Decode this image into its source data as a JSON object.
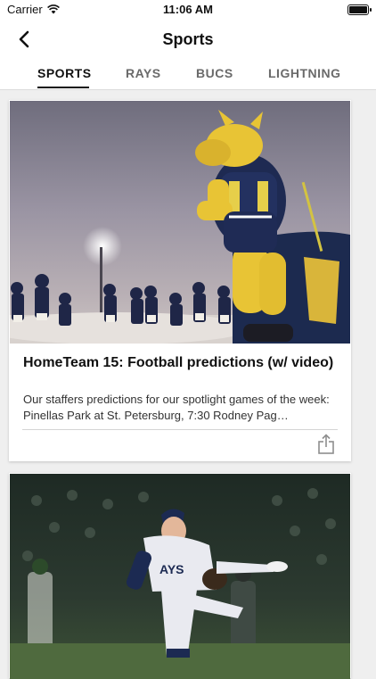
{
  "status_bar": {
    "carrier": "Carrier",
    "time": "11:06 AM"
  },
  "nav": {
    "title": "Sports"
  },
  "tabs": [
    {
      "label": "SPORTS",
      "active": true
    },
    {
      "label": "RAYS",
      "active": false
    },
    {
      "label": "BUCS",
      "active": false
    },
    {
      "label": "LIGHTNING",
      "active": false
    }
  ],
  "articles": [
    {
      "headline": "HomeTeam 15: Football predictions (w/ video)",
      "summary": "Our staffers predictions for our spotlight games of the week: Pinellas Park at St. Petersburg, 7:30 Rodney Pag…"
    },
    {
      "headline": "",
      "summary": ""
    }
  ],
  "colors": {
    "background": "#efefef",
    "active_tab": "#111111",
    "inactive_tab": "#6a6a6a",
    "accent_team": "#1c2a4f"
  }
}
